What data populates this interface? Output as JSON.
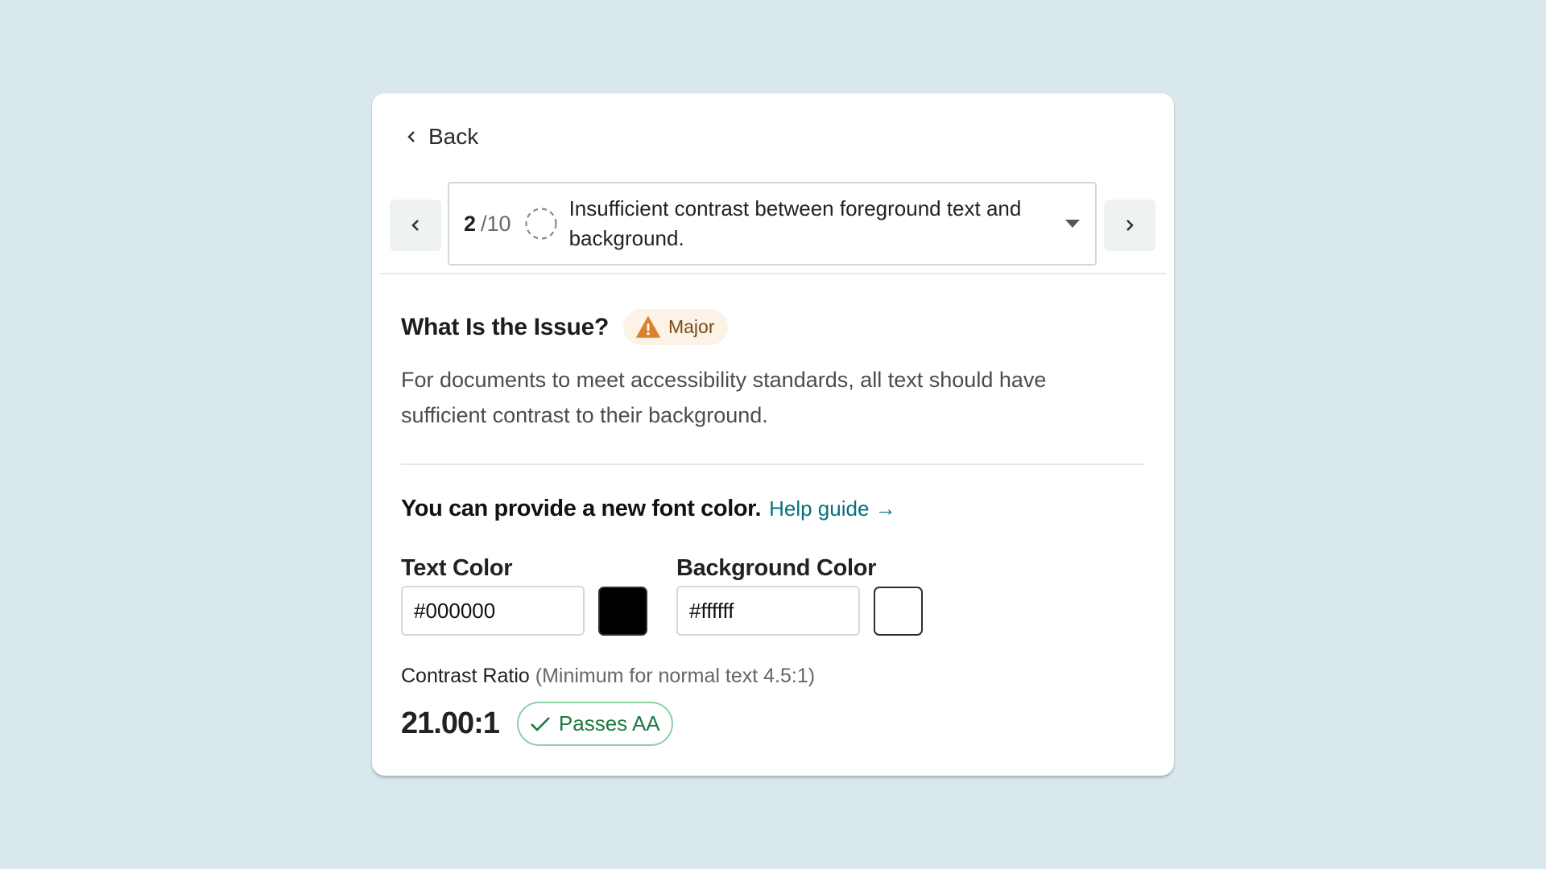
{
  "back": {
    "label": "Back"
  },
  "issue_nav": {
    "current": "2",
    "total": "/10",
    "title": "Insufficient contrast between foreground text and background."
  },
  "issue": {
    "heading": "What Is the Issue?",
    "severity": "Major",
    "description": "For documents to meet accessibility standards, all text should have sufficient contrast to their background."
  },
  "fix": {
    "prompt": "You can provide a new font color.",
    "help_link": "Help guide →"
  },
  "text_color": {
    "label": "Text Color",
    "value": "#000000",
    "swatch": "#000000"
  },
  "background_color": {
    "label": "Background Color",
    "value": "#ffffff",
    "swatch": "#ffffff"
  },
  "contrast": {
    "label": "Contrast Ratio",
    "hint": "(Minimum for normal text 4.5:1)",
    "value": "21.00:1",
    "status": "Passes AA"
  },
  "colors": {
    "page_background": "#d9e8ec",
    "severity_bg": "#fdf2e6",
    "severity_icon": "#d9822b",
    "pass_border": "#8fd0a7",
    "pass_text": "#1a7a40",
    "link": "#0a6e80"
  }
}
